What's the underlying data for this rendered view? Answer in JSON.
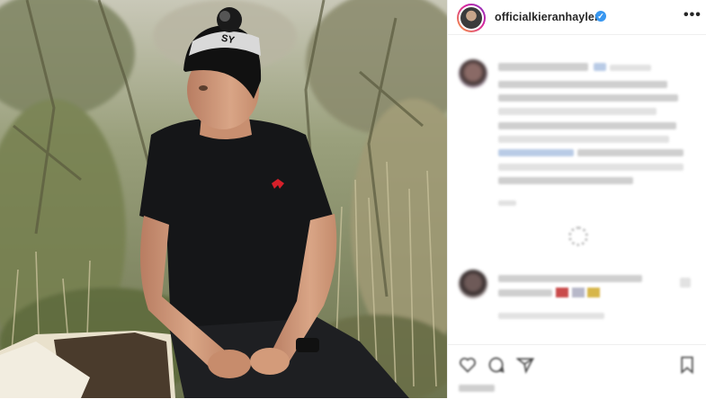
{
  "post": {
    "author": {
      "username": "officialkieranhayler",
      "verified": true
    },
    "verified_glyph": "✓",
    "more_glyph": "•••",
    "hat_text": "SY",
    "icons": {
      "verified": "verified-badge-icon",
      "more": "more-options-icon",
      "like": "heart-icon",
      "comment": "comment-icon",
      "share": "share-icon",
      "save": "bookmark-icon",
      "loading": "loading-spinner-icon"
    },
    "colors": {
      "verified_blue": "#3897f0",
      "logo_red": "#d6202a",
      "border": "#efefef",
      "text": "#262626"
    }
  }
}
